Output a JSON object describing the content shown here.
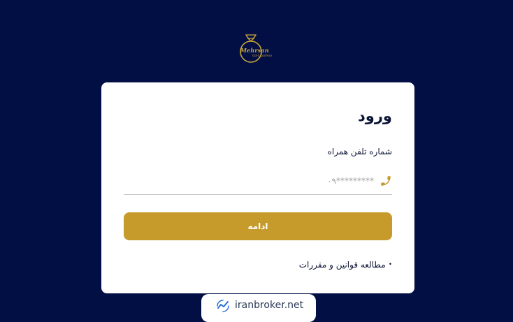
{
  "logo": {
    "name": "Mehrsan",
    "tagline": "Gold Gallery"
  },
  "login": {
    "title": "ورود",
    "phone_label": "شماره تلفن همراه",
    "phone_placeholder": "۰۹*********",
    "phone_value": "",
    "continue_label": "ادامه",
    "terms_bullet": "•",
    "terms_link": "مطالعه قوانین و مقررات"
  },
  "watermark": {
    "text": "iranbroker.net"
  },
  "colors": {
    "background": "#010f45",
    "accent": "#c69a2b",
    "card": "#ffffff"
  },
  "icons": {
    "phone": "phone-icon",
    "logo": "ring-logo-icon",
    "badge": "chart-trend-icon"
  }
}
